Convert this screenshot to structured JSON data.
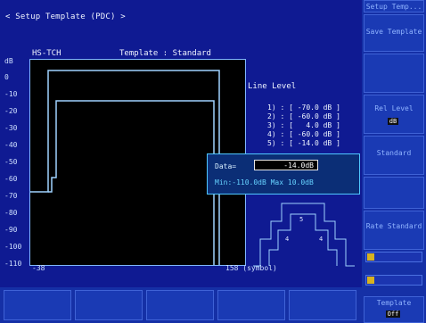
{
  "header": {
    "title": "< Setup Template (PDC) >",
    "mode": "HS-TCH",
    "template": "Template : Standard"
  },
  "graph": {
    "unit": "dB",
    "y_ticks": [
      "0",
      "-10",
      "-20",
      "-30",
      "-40",
      "-50",
      "-60",
      "-70",
      "-80",
      "-90",
      "-100",
      "-110"
    ],
    "x_left_label": "-38",
    "x_right_label": "158 (symbol)"
  },
  "line_level": {
    "title": "Line Level",
    "items": [
      "1) : [ -70.0 dB ]",
      "2) : [ -60.0 dB ]",
      "3) : [   4.0 dB ]",
      "4) : [ -60.0 dB ]",
      "5) : [ -14.0 dB ]"
    ]
  },
  "edit_popup": {
    "label": "Data=",
    "value": "-14.0dB",
    "range": "Min:-110.0dB  Max 10.0dB"
  },
  "softkeys": {
    "top": "Setup Temp...",
    "k1": "Save Template",
    "k2": "",
    "k3": "Rel Level",
    "k3_chip": "dB",
    "k4": "Standard",
    "k5": "",
    "k6": "Rate Standard",
    "k7": "",
    "bottom": "Template",
    "bottom_chip": "Off"
  },
  "colors": {
    "background": "#0f1a92",
    "trace": "#9fd3ff",
    "popup_border": "#4fc7ff"
  }
}
